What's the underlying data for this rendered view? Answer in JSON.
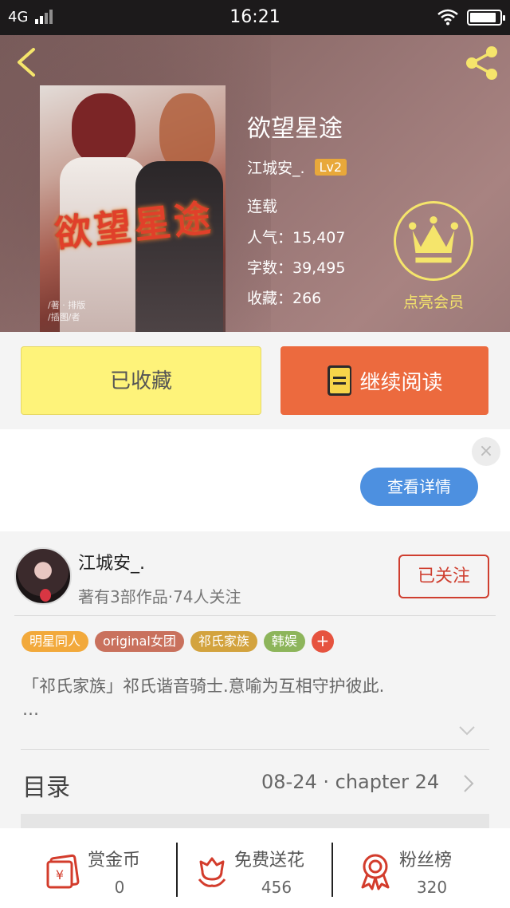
{
  "status_bar": {
    "network": "4G",
    "time": "16:21",
    "battery_level": 0.9
  },
  "book": {
    "title": "欲望星途",
    "author": "江城安_.",
    "level": "Lv2",
    "status": "连载",
    "popularity": "人气：15,407",
    "word_count": "字数：39,495",
    "favorites": "收藏：266",
    "cover_title": "欲望星途",
    "cover_sub": "/著 · 排版\n/插图/者"
  },
  "vip": {
    "label": "点亮会员",
    "color": "#f5e56b"
  },
  "actions": {
    "collected_label": "已收藏",
    "read_label": "继续阅读"
  },
  "ad": {
    "close_symbol": "×",
    "detail_label": "查看详情"
  },
  "author_card": {
    "name": "江城安_.",
    "stats": "著有3部作品·74人关注",
    "follow_label": "已关注",
    "tags": [
      {
        "label": "明星同人",
        "color": "#f2a93b"
      },
      {
        "label": "original女团",
        "color": "#c9715d"
      },
      {
        "label": "祁氏家族",
        "color": "#d3a33e"
      },
      {
        "label": "韩娱",
        "color": "#8db55b"
      }
    ],
    "tag_add": "+",
    "description": "「祁氏家族」祁氏谐音骑士.意喻为互相守护彼此.",
    "description_more": "…"
  },
  "toc": {
    "label": "目录",
    "latest": "08-24 · chapter 24"
  },
  "bottom_bar": {
    "reward_label": "赏金币",
    "reward_value": "0",
    "flower_label": "免费送花",
    "flower_value": "456",
    "fans_label": "粉丝榜",
    "fans_value": "320"
  }
}
